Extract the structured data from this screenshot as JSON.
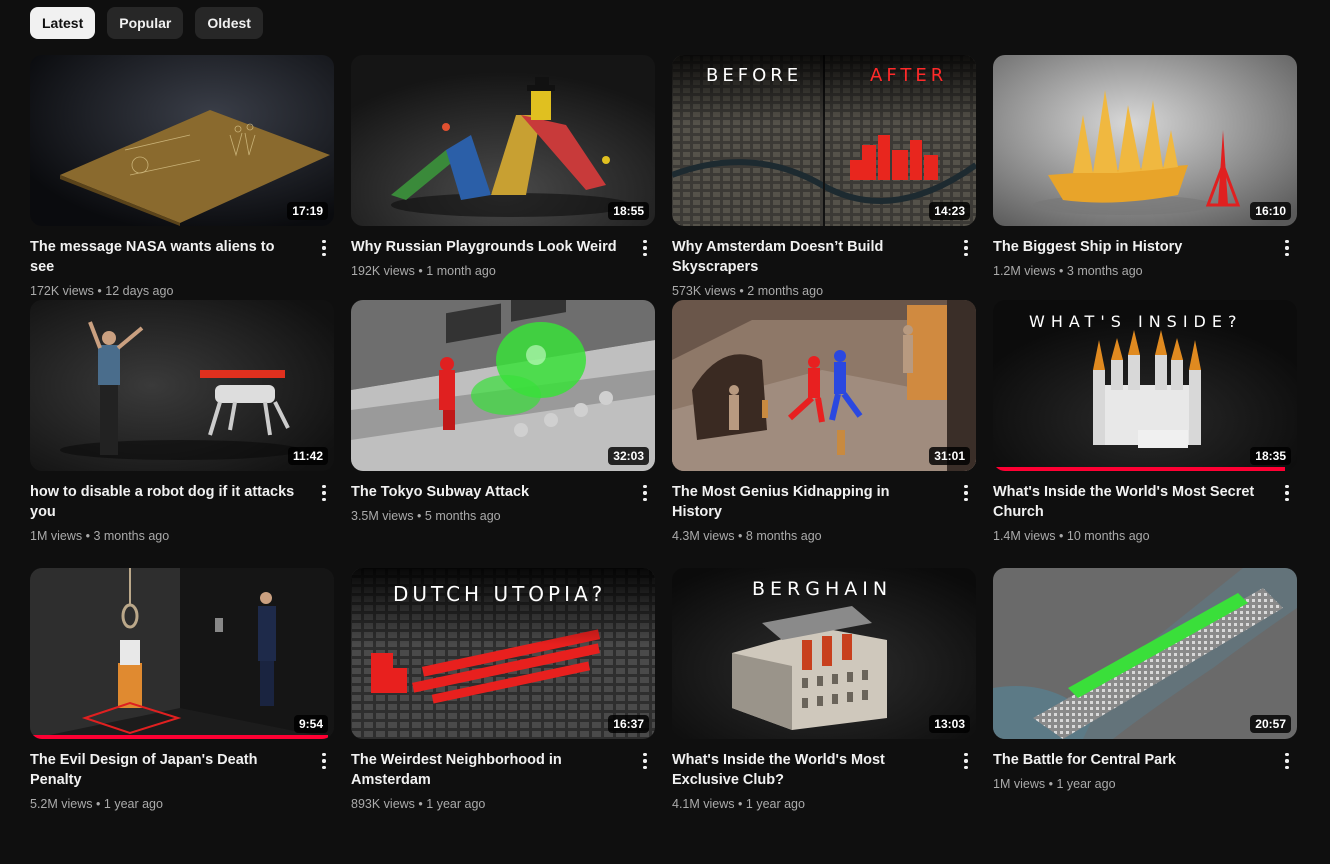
{
  "filters": [
    {
      "label": "Latest",
      "active": true
    },
    {
      "label": "Popular",
      "active": false
    },
    {
      "label": "Oldest",
      "active": false
    }
  ],
  "videos": [
    {
      "title": "The message NASA wants aliens to see",
      "views": "172K views",
      "age": "12 days ago",
      "duration": "17:19",
      "thumb_icon": "golden-plaque-thumbnail",
      "watched": 0
    },
    {
      "title": "Why Russian Playgrounds Look Weird",
      "views": "192K views",
      "age": "1 month ago",
      "duration": "18:55",
      "thumb_icon": "playground-thumbnail",
      "watched": 0
    },
    {
      "title": "Why Amsterdam Doesn’t Build Skyscrapers",
      "views": "573K views",
      "age": "2 months ago",
      "duration": "14:23",
      "thumb_icon": "amsterdam-before-after-thumbnail",
      "overlay_left": "BEFORE",
      "overlay_right": "AFTER",
      "watched": 0
    },
    {
      "title": "The Biggest Ship in History",
      "views": "1.2M views",
      "age": "3 months ago",
      "duration": "16:10",
      "thumb_icon": "golden-ship-thumbnail",
      "watched": 0
    },
    {
      "title": "how to disable a robot dog if it attacks you",
      "views": "1M views",
      "age": "3 months ago",
      "duration": "11:42",
      "thumb_icon": "robot-dog-thumbnail",
      "watched": 0
    },
    {
      "title": "The Tokyo Subway Attack",
      "views": "3.5M views",
      "age": "5 months ago",
      "duration": "32:03",
      "thumb_icon": "subway-gas-thumbnail",
      "watched": 0
    },
    {
      "title": "The Most Genius Kidnapping in History",
      "views": "4.3M views",
      "age": "8 months ago",
      "duration": "31:01",
      "thumb_icon": "kidnapping-figures-thumbnail",
      "watched": 0
    },
    {
      "title": "What's Inside the World's Most Secret Church",
      "views": "1.4M views",
      "age": "10 months ago",
      "duration": "18:35",
      "thumb_icon": "white-temple-thumbnail",
      "overlay_top": "WHAT'S INSIDE?",
      "watched": 0.96
    },
    {
      "title": "The Evil Design of Japan's Death Penalty",
      "views": "5.2M views",
      "age": "1 year ago",
      "duration": "9:54",
      "thumb_icon": "gallows-thumbnail",
      "watched": 0.98
    },
    {
      "title": "The Weirdest Neighborhood in Amsterdam",
      "views": "893K views",
      "age": "1 year ago",
      "duration": "16:37",
      "thumb_icon": "dutch-utopia-thumbnail",
      "overlay_top": "DUTCH UTOPIA?",
      "watched": 0
    },
    {
      "title": "What's Inside the World's Most Exclusive Club?",
      "views": "4.1M views",
      "age": "1 year ago",
      "duration": "13:03",
      "thumb_icon": "berghain-building-thumbnail",
      "overlay_top": "BERGHAIN",
      "watched": 0
    },
    {
      "title": "The Battle for Central Park",
      "views": "1M views",
      "age": "1 year ago",
      "duration": "20:57",
      "thumb_icon": "central-park-map-thumbnail",
      "watched": 0
    }
  ],
  "separator": "•"
}
